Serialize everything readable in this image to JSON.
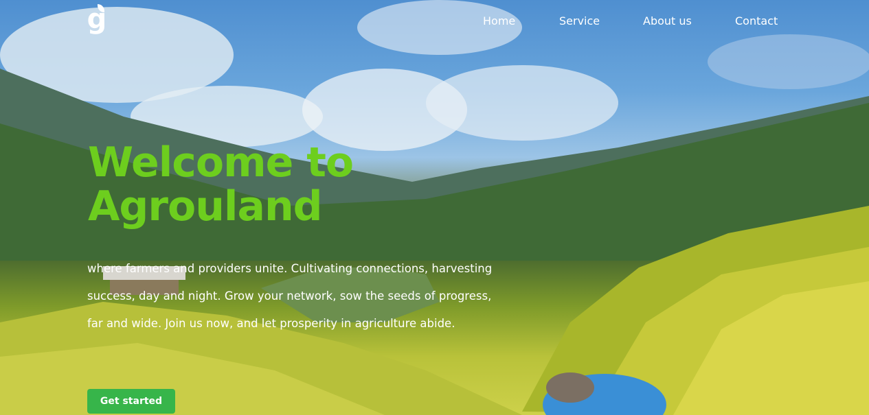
{
  "brand": {
    "logo_letter": "g"
  },
  "nav": {
    "items": [
      {
        "label": "Home"
      },
      {
        "label": "Service"
      },
      {
        "label": "About us"
      },
      {
        "label": "Contact"
      }
    ]
  },
  "hero": {
    "title_line1": "Welcome to",
    "title_line2": "Agrouland",
    "description": "where farmers and providers unite. Cultivating connections, harvesting success, day and night. Grow your network, sow the seeds of progress, far and wide. Join us now, and let prosperity in agriculture abide.",
    "cta_label": "Get started"
  },
  "colors": {
    "title": "#6dce1e",
    "cta_background": "#37b54a",
    "nav_text": "#ffffff"
  }
}
